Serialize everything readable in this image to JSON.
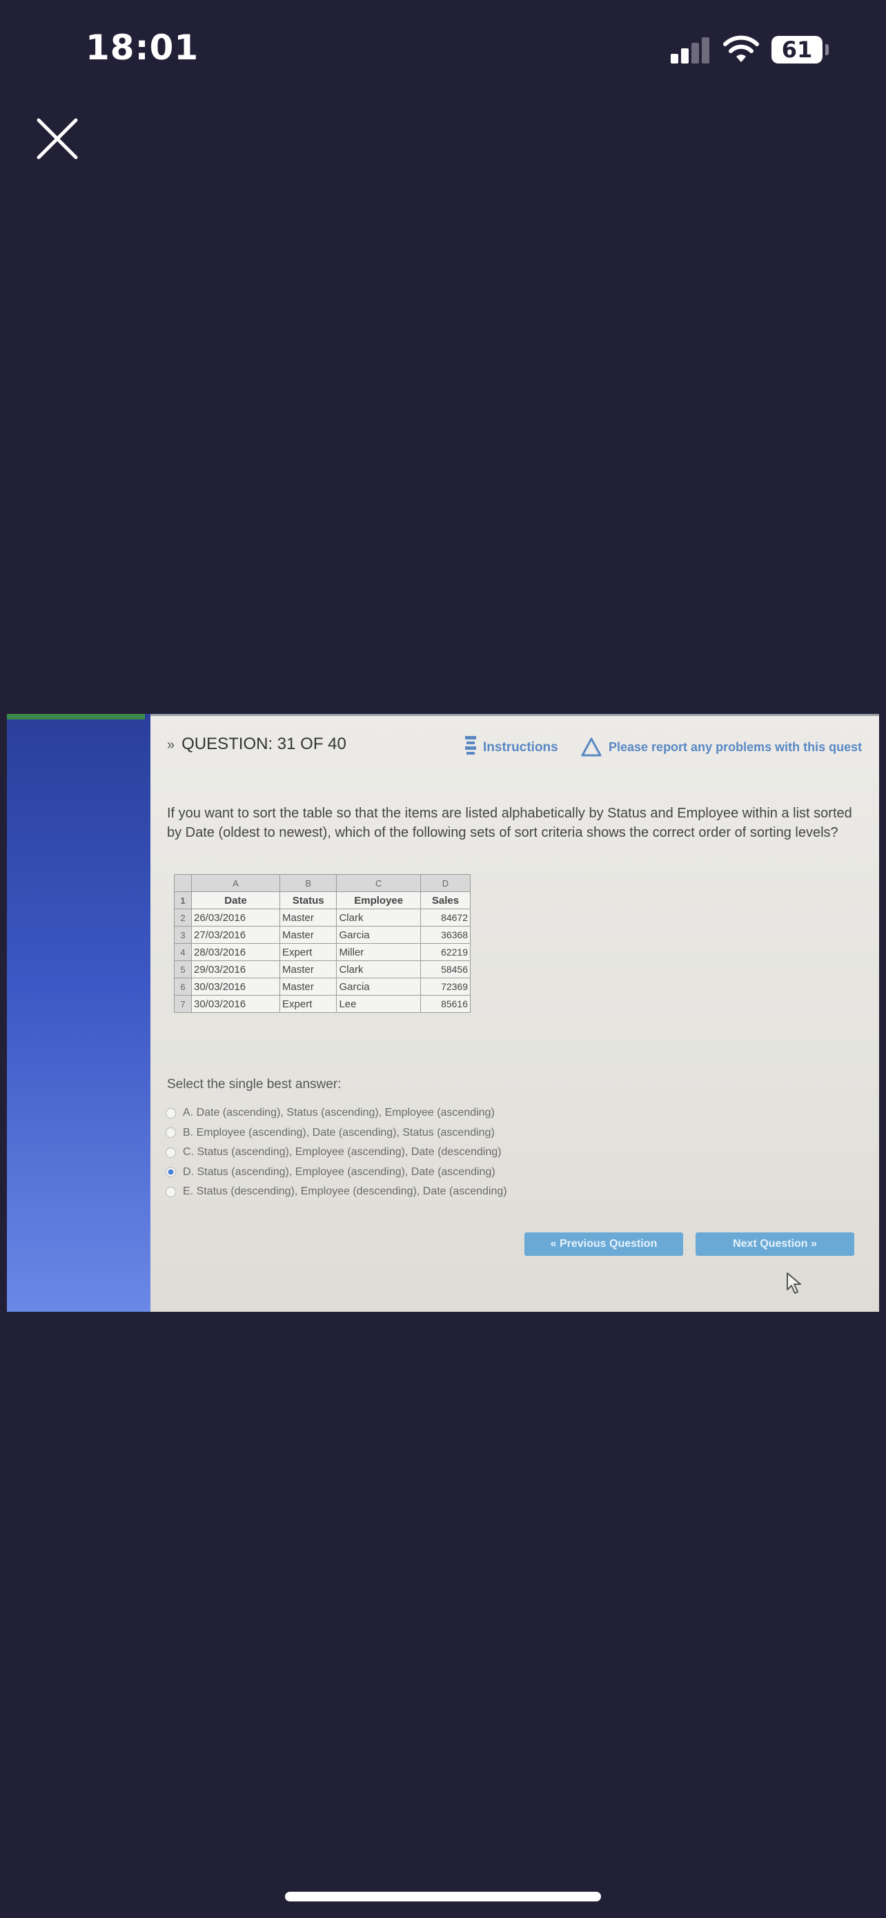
{
  "status_bar": {
    "time": "18:01",
    "battery": "61"
  },
  "question": {
    "header": "QUESTION: 31 OF 40",
    "instructions_link": "Instructions",
    "report_link": "Please report any problems with this quest",
    "text": "If you want to sort the table so that the items are listed alphabetically by Status and Employee within a list sorted by Date (oldest to newest), which of the following sets of sort criteria shows the correct order of sorting levels?",
    "select_label": "Select the single best answer:",
    "selected_option": 3,
    "options": [
      "A. Date (ascending), Status (ascending), Employee (ascending)",
      "B. Employee (ascending), Date (ascending), Status (ascending)",
      "C. Status (ascending), Employee (ascending), Date (descending)",
      "D. Status (ascending), Employee (ascending), Date (ascending)",
      "E. Status (descending), Employee (descending), Date (ascending)"
    ],
    "prev_button": "« Previous Question",
    "next_button": "Next Question »"
  },
  "spreadsheet": {
    "column_letters": [
      "A",
      "B",
      "C",
      "D"
    ],
    "headers": [
      "Date",
      "Status",
      "Employee",
      "Sales"
    ],
    "rows": [
      [
        "26/03/2016",
        "Master",
        "Clark",
        "84672"
      ],
      [
        "27/03/2016",
        "Master",
        "Garcia",
        "36368"
      ],
      [
        "28/03/2016",
        "Expert",
        "Miller",
        "62219"
      ],
      [
        "29/03/2016",
        "Master",
        "Clark",
        "58456"
      ],
      [
        "30/03/2016",
        "Master",
        "Garcia",
        "72369"
      ],
      [
        "30/03/2016",
        "Expert",
        "Lee",
        "85616"
      ]
    ],
    "row_numbers": [
      "1",
      "2",
      "3",
      "4",
      "5",
      "6",
      "7"
    ]
  }
}
